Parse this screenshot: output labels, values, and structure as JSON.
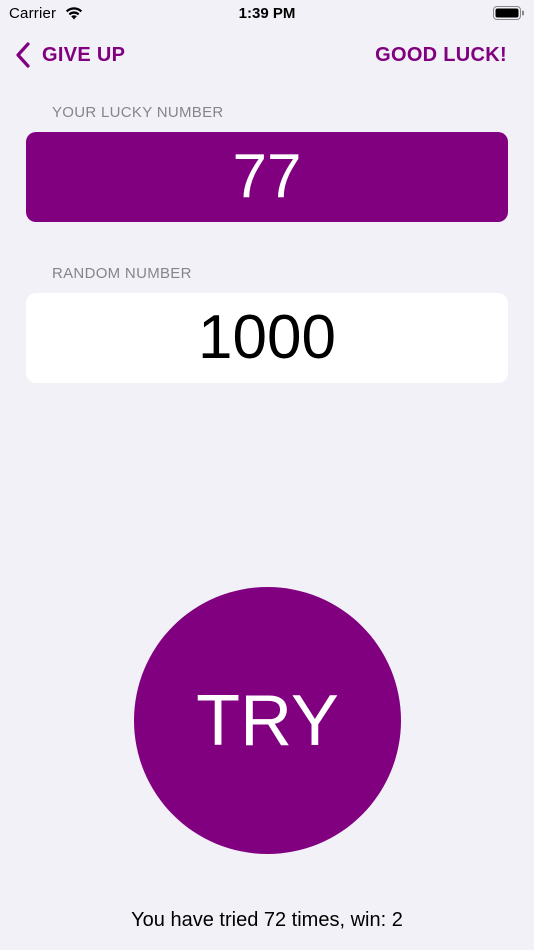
{
  "status_bar": {
    "carrier": "Carrier",
    "time": "1:39 PM"
  },
  "nav": {
    "back_label": "GIVE UP",
    "right_label": "GOOD LUCK!"
  },
  "lucky": {
    "label": "YOUR LUCKY NUMBER",
    "value": "77"
  },
  "random": {
    "label": "RANDOM NUMBER",
    "value": "1000"
  },
  "try_button": {
    "label": "TRY"
  },
  "stats": {
    "text": "You have tried 72 times, win: 2"
  },
  "colors": {
    "accent": "#800080",
    "background": "#f2f1f7",
    "label_gray": "#85858a"
  },
  "icons": {
    "wifi": "wifi-icon",
    "battery": "battery-icon",
    "back": "chevron-left-icon"
  }
}
